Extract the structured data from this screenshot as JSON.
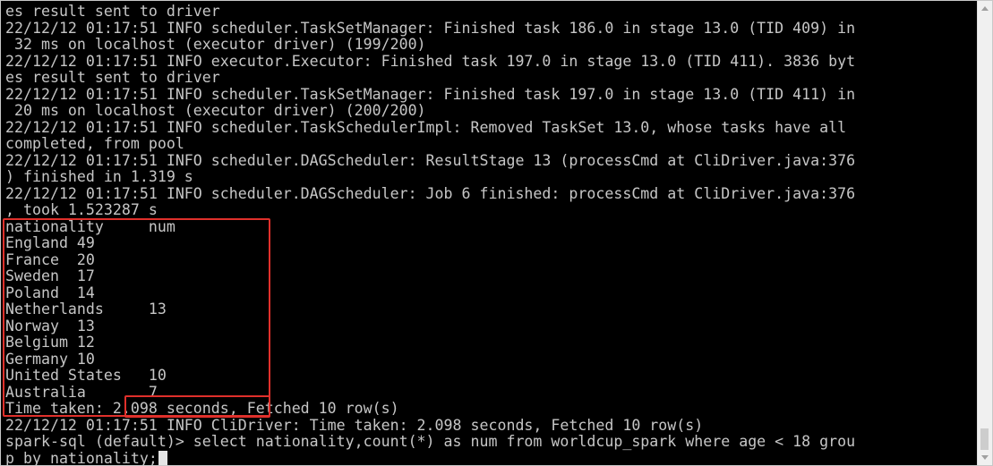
{
  "terminal": {
    "lines": [
      "es result sent to driver",
      "22/12/12 01:17:51 INFO scheduler.TaskSetManager: Finished task 186.0 in stage 13.0 (TID 409) in",
      " 32 ms on localhost (executor driver) (199/200)",
      "22/12/12 01:17:51 INFO executor.Executor: Finished task 197.0 in stage 13.0 (TID 411). 3836 byt",
      "es result sent to driver",
      "22/12/12 01:17:51 INFO scheduler.TaskSetManager: Finished task 197.0 in stage 13.0 (TID 411) in",
      " 20 ms on localhost (executor driver) (200/200)",
      "22/12/12 01:17:51 INFO scheduler.TaskSchedulerImpl: Removed TaskSet 13.0, whose tasks have all",
      "completed, from pool",
      "22/12/12 01:17:51 INFO scheduler.DAGScheduler: ResultStage 13 (processCmd at CliDriver.java:376",
      ") finished in 1.319 s",
      "22/12/12 01:17:51 INFO scheduler.DAGScheduler: Job 6 finished: processCmd at CliDriver.java:376",
      ", took 1.523287 s",
      "nationality     num",
      "England 49",
      "France  20",
      "Sweden  17",
      "Poland  14",
      "Netherlands     13",
      "Norway  13",
      "Belgium 12",
      "Germany 10",
      "United States   10",
      "Australia       7",
      "Time taken: 2.098 seconds, Fetched 10 row(s)",
      "22/12/12 01:17:51 INFO CliDriver: Time taken: 2.098 seconds, Fetched 10 row(s)",
      "spark-sql (default)> select nationality,count(*) as num from worldcup_spark where age < 18 grou",
      "p by nationality;"
    ]
  },
  "colors": {
    "background": "#000000",
    "text": "#c6c6c6",
    "highlight": "#e0302b",
    "cursor": "#e4e4e4"
  }
}
